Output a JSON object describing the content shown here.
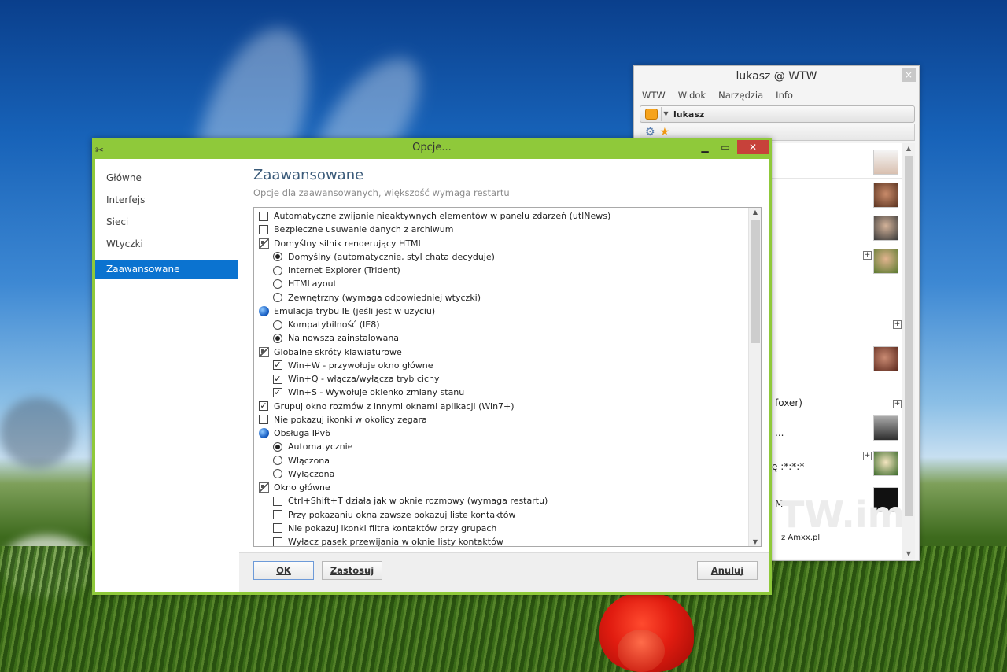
{
  "wtw": {
    "title": "lukasz @ WTW",
    "close": "×",
    "menu": [
      "WTW",
      "Widok",
      "Narzędzia",
      "Info"
    ],
    "username": "lukasz",
    "partial_texts": [
      "foxer)",
      "...",
      "ę :*:*:*",
      "M",
      "z Amxx.pl"
    ],
    "watermark": "TW.im"
  },
  "dialog": {
    "title": "Opcje...",
    "sidebar": [
      "Główne",
      "Interfejs",
      "Sieci",
      "Wtyczki",
      "Zaawansowane"
    ],
    "selected_index": 4,
    "heading": "Zaawansowane",
    "subtitle": "Opcje dla zaawansowanych, większość wymaga restartu",
    "options": [
      {
        "type": "checkbox",
        "level": 0,
        "checked": false,
        "label": "Automatyczne zwijanie nieaktywnych elementów w panelu zdarzeń (utlNews)"
      },
      {
        "type": "checkbox",
        "level": 0,
        "checked": false,
        "label": "Bezpieczne usuwanie danych z archiwum"
      },
      {
        "type": "group",
        "level": 0,
        "label": "Domyślny silnik renderujący HTML"
      },
      {
        "type": "radio",
        "level": 1,
        "checked": true,
        "label": "Domyślny (automatycznie, styl chata decyduje)"
      },
      {
        "type": "radio",
        "level": 1,
        "checked": false,
        "label": "Internet Explorer (Trident)"
      },
      {
        "type": "radio",
        "level": 1,
        "checked": false,
        "label": "HTMLayout"
      },
      {
        "type": "radio",
        "level": 1,
        "checked": false,
        "label": "Zewnętrzny (wymaga odpowiedniej wtyczki)"
      },
      {
        "type": "globe",
        "level": 0,
        "label": "Emulacja trybu IE (jeśli jest w uzyciu)"
      },
      {
        "type": "radio",
        "level": 1,
        "checked": false,
        "label": "Kompatybilność (IE8)"
      },
      {
        "type": "radio",
        "level": 1,
        "checked": true,
        "label": "Najnowsza zainstalowana"
      },
      {
        "type": "group",
        "level": 0,
        "label": "Globalne skróty klawiaturowe"
      },
      {
        "type": "checkbox",
        "level": 1,
        "checked": true,
        "label": "Win+W - przywołuje okno główne"
      },
      {
        "type": "checkbox",
        "level": 1,
        "checked": true,
        "label": "Win+Q - włącza/wyłącza tryb cichy"
      },
      {
        "type": "checkbox",
        "level": 1,
        "checked": true,
        "label": "Win+S - Wywołuje okienko zmiany stanu"
      },
      {
        "type": "checkbox",
        "level": 0,
        "checked": true,
        "label": "Grupuj okno rozmów z innymi oknami aplikacji (Win7+)"
      },
      {
        "type": "checkbox",
        "level": 0,
        "checked": false,
        "label": "Nie pokazuj ikonki w okolicy zegara"
      },
      {
        "type": "globe",
        "level": 0,
        "label": "Obsługa IPv6"
      },
      {
        "type": "radio",
        "level": 1,
        "checked": true,
        "label": "Automatycznie"
      },
      {
        "type": "radio",
        "level": 1,
        "checked": false,
        "label": "Włączona"
      },
      {
        "type": "radio",
        "level": 1,
        "checked": false,
        "label": "Wyłączona"
      },
      {
        "type": "group",
        "level": 0,
        "label": "Okno główne"
      },
      {
        "type": "checkbox",
        "level": 1,
        "checked": false,
        "label": "Ctrl+Shift+T działa jak w oknie rozmowy (wymaga restartu)"
      },
      {
        "type": "checkbox",
        "level": 1,
        "checked": false,
        "label": "Przy pokazaniu okna zawsze pokazuj liste kontaktów"
      },
      {
        "type": "checkbox",
        "level": 1,
        "checked": false,
        "label": "Nie pokazuj ikonki filtra kontaktów przy grupach"
      },
      {
        "type": "checkbox",
        "level": 1,
        "checked": false,
        "label": "Wyłacz pasek przewijania w oknie listy kontaktów"
      }
    ],
    "buttons": {
      "ok": "OK",
      "apply": "Zastosuj",
      "cancel": "Anuluj"
    }
  },
  "colors": {
    "dialog_frame": "#8fc93a",
    "selection": "#0b73d0",
    "close_button": "#c7413a"
  }
}
